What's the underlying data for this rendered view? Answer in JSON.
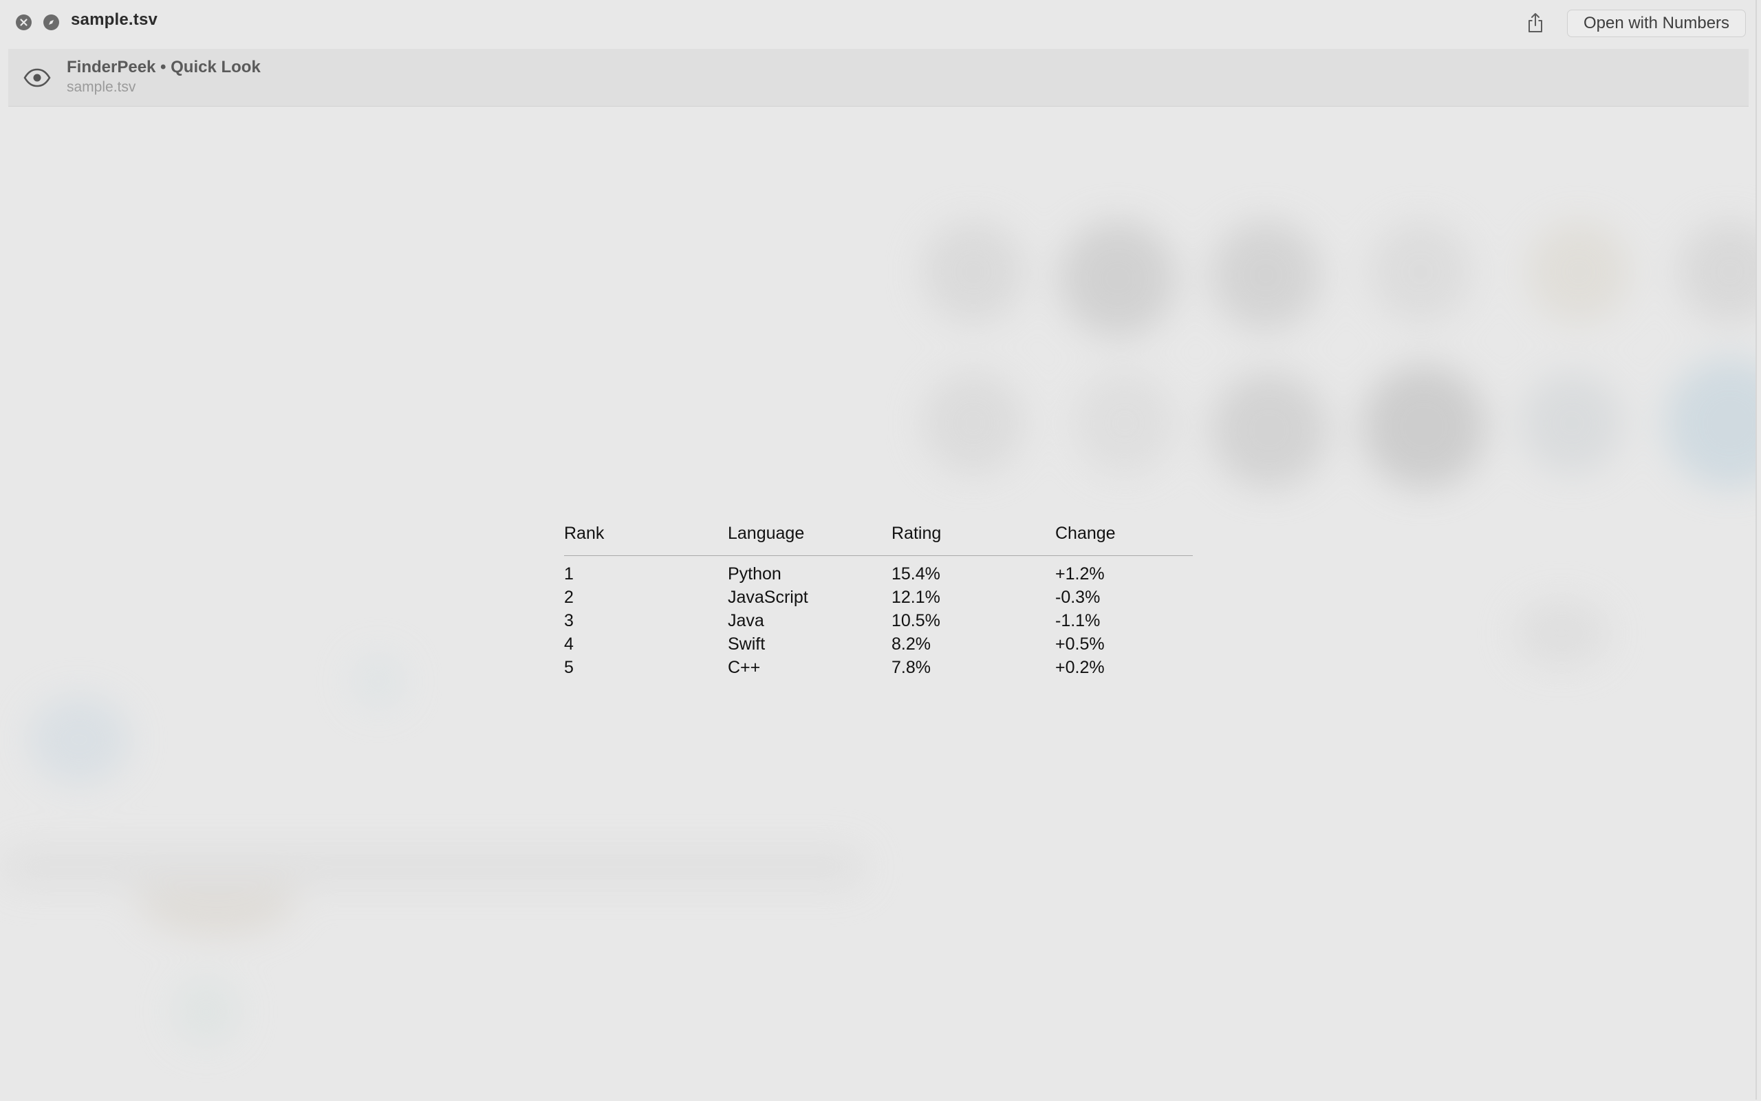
{
  "window": {
    "title": "sample.tsv",
    "close_icon": "close-icon",
    "fullscreen_icon": "compass-icon",
    "share_icon": "share-icon",
    "open_button_label": "Open with Numbers"
  },
  "banner": {
    "icon": "eye-icon",
    "title": "FinderPeek • Quick Look",
    "subtitle": "sample.tsv"
  },
  "table": {
    "headers": [
      "Rank",
      "Language",
      "Rating",
      "Change"
    ],
    "rows": [
      [
        "1",
        "Python",
        "15.4%",
        "+1.2%"
      ],
      [
        "2",
        "JavaScript",
        "12.1%",
        "-0.3%"
      ],
      [
        "3",
        "Java",
        "10.5%",
        "-1.1%"
      ],
      [
        "4",
        "Swift",
        "8.2%",
        "+0.5%"
      ],
      [
        "5",
        "C++",
        "7.8%",
        "+0.2%"
      ]
    ]
  }
}
